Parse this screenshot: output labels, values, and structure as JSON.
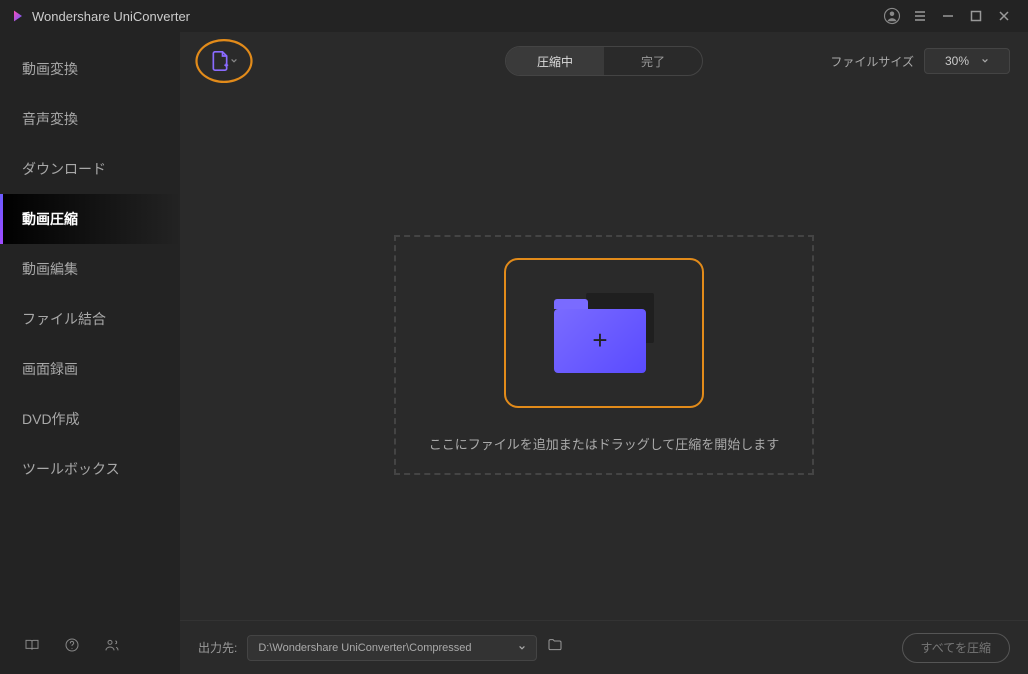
{
  "app": {
    "title": "Wondershare UniConverter"
  },
  "sidebar": {
    "items": [
      {
        "label": "動画変換"
      },
      {
        "label": "音声変換"
      },
      {
        "label": "ダウンロード"
      },
      {
        "label": "動画圧縮"
      },
      {
        "label": "動画編集"
      },
      {
        "label": "ファイル結合"
      },
      {
        "label": "画面録画"
      },
      {
        "label": "DVD作成"
      },
      {
        "label": "ツールボックス"
      }
    ],
    "active_index": 3
  },
  "toolbar": {
    "tabs": {
      "compressing": "圧縮中",
      "done": "完了"
    },
    "filesize_label": "ファイルサイズ",
    "filesize_value": "30%"
  },
  "dropzone": {
    "text": "ここにファイルを追加またはドラッグして圧縮を開始します"
  },
  "bottombar": {
    "output_label": "出力先:",
    "output_path": "D:\\Wondershare UniConverter\\Compressed",
    "compress_all": "すべてを圧縮"
  }
}
